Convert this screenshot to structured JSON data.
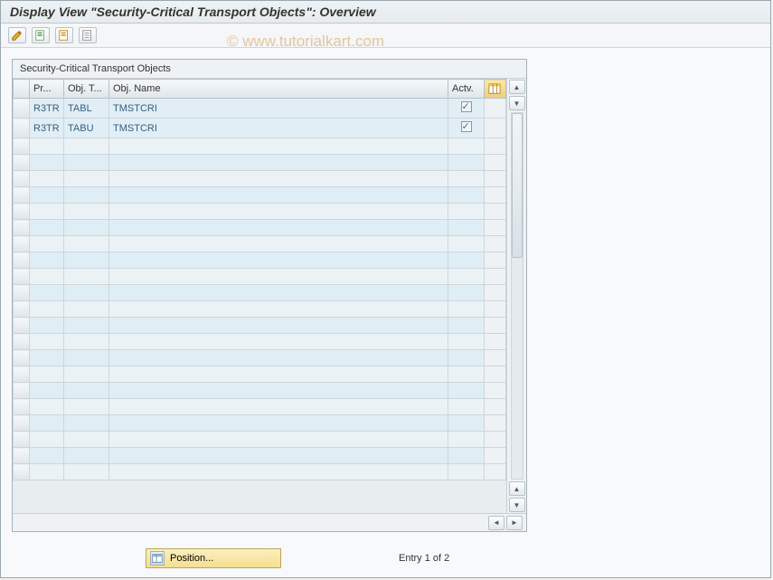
{
  "header": {
    "title": "Display View \"Security-Critical Transport Objects\": Overview"
  },
  "watermark": "© www.tutorialkart.com",
  "toolbar": {
    "icons": [
      "edit-icon",
      "sheet-green-icon",
      "sheet-orange-icon",
      "sheet-lines-icon"
    ]
  },
  "grid": {
    "title": "Security-Critical Transport Objects",
    "columns": {
      "pr": "Pr...",
      "objType": "Obj. T...",
      "objName": "Obj. Name",
      "actv": "Actv."
    },
    "rows": [
      {
        "pr": "R3TR",
        "objType": "TABL",
        "objName": "TMSTCRI",
        "actv": true
      },
      {
        "pr": "R3TR",
        "objType": "TABU",
        "objName": "TMSTCRI",
        "actv": true
      }
    ],
    "emptyRowCount": 21
  },
  "footer": {
    "positionLabel": "Position...",
    "entryText": "Entry 1 of 2"
  }
}
